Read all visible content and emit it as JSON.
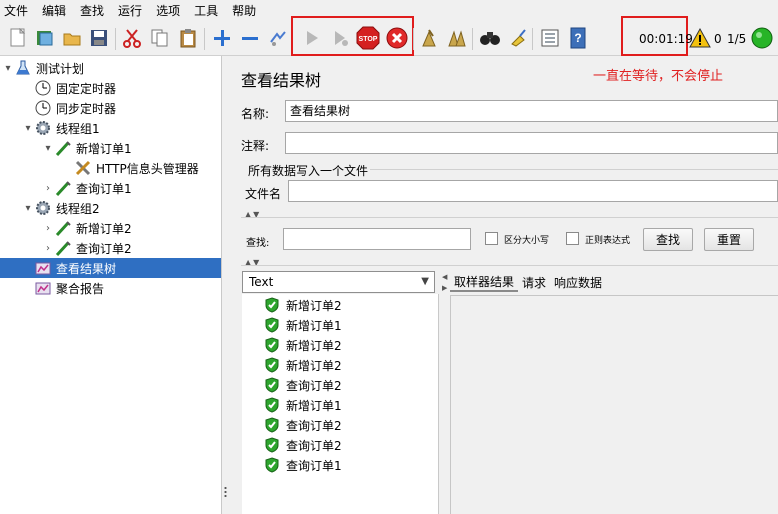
{
  "menu": [
    "文件",
    "编辑",
    "查找",
    "运行",
    "选项",
    "工具",
    "帮助"
  ],
  "toolbar": {
    "icons": [
      "new-icon",
      "templates-icon",
      "open-icon",
      "save-icon",
      "cut-icon",
      "copy-icon",
      "paste-icon",
      "expand-icon",
      "collapse-icon",
      "toggle-icon",
      "start-icon",
      "start-no-pause-icon",
      "stop-icon",
      "shutdown-icon",
      "clear-icon",
      "clear-all-icon",
      "search-icon",
      "reset-search-icon",
      "function-helper-icon",
      "help-icon"
    ],
    "stop_label": "STOP",
    "elapsed": "00:01:19",
    "warnings": "0",
    "threads": "1/5",
    "colors": {
      "annotation": "#e01c1c",
      "running": "#27b427"
    }
  },
  "tree": {
    "nodes": [
      {
        "label": "测试计划",
        "expand": "▾",
        "icon": "flask-icon"
      },
      {
        "label": "固定定时器",
        "expand": "",
        "icon": "timer-icon"
      },
      {
        "label": "同步定时器",
        "expand": "",
        "icon": "timer-icon"
      },
      {
        "label": "线程组1",
        "expand": "▾",
        "icon": "gear-icon"
      },
      {
        "label": "新增订单1",
        "expand": "▾",
        "icon": "sampler-icon"
      },
      {
        "label": "HTTP信息头管理器",
        "expand": "",
        "icon": "tools-icon"
      },
      {
        "label": "查询订单1",
        "expand": "›",
        "icon": "sampler-icon"
      },
      {
        "label": "线程组2",
        "expand": "▾",
        "icon": "gear-icon"
      },
      {
        "label": "新增订单2",
        "expand": "›",
        "icon": "sampler-icon"
      },
      {
        "label": "查询订单2",
        "expand": "›",
        "icon": "sampler-icon"
      },
      {
        "label": "查看结果树",
        "expand": "",
        "icon": "listener-icon",
        "selected": true
      },
      {
        "label": "聚合报告",
        "expand": "",
        "icon": "listener-icon"
      }
    ]
  },
  "panel": {
    "title": "查看结果树",
    "annotation": "一直在等待，不会停止",
    "name_label": "名称:",
    "name_value": "查看结果树",
    "comment_label": "注释:",
    "comment_value": "",
    "file_group": "所有数据写入一个文件",
    "filename_label": "文件名",
    "filename_value": "",
    "search_label": "查找:",
    "search_value": "",
    "case_sensitive": "区分大小写",
    "regex": "正则表达式",
    "search_btn": "查找",
    "reset_btn": "重置",
    "renderer": "Text",
    "results": [
      "新增订单2",
      "新增订单1",
      "新增订单2",
      "新增订单2",
      "查询订单2",
      "新增订单1",
      "查询订单2",
      "查询订单2",
      "查询订单1"
    ],
    "tabs": [
      "取样器结果",
      "请求",
      "响应数据"
    ]
  }
}
